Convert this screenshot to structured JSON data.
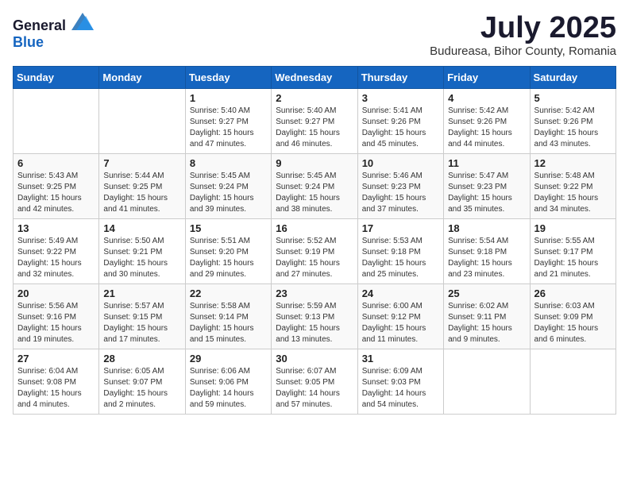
{
  "logo": {
    "text_general": "General",
    "text_blue": "Blue"
  },
  "title": {
    "month_year": "July 2025",
    "location": "Budureasa, Bihor County, Romania"
  },
  "days_of_week": [
    "Sunday",
    "Monday",
    "Tuesday",
    "Wednesday",
    "Thursday",
    "Friday",
    "Saturday"
  ],
  "weeks": [
    [
      {
        "day": "",
        "sunrise": "",
        "sunset": "",
        "daylight": ""
      },
      {
        "day": "",
        "sunrise": "",
        "sunset": "",
        "daylight": ""
      },
      {
        "day": "1",
        "sunrise": "Sunrise: 5:40 AM",
        "sunset": "Sunset: 9:27 PM",
        "daylight": "Daylight: 15 hours and 47 minutes."
      },
      {
        "day": "2",
        "sunrise": "Sunrise: 5:40 AM",
        "sunset": "Sunset: 9:27 PM",
        "daylight": "Daylight: 15 hours and 46 minutes."
      },
      {
        "day": "3",
        "sunrise": "Sunrise: 5:41 AM",
        "sunset": "Sunset: 9:26 PM",
        "daylight": "Daylight: 15 hours and 45 minutes."
      },
      {
        "day": "4",
        "sunrise": "Sunrise: 5:42 AM",
        "sunset": "Sunset: 9:26 PM",
        "daylight": "Daylight: 15 hours and 44 minutes."
      },
      {
        "day": "5",
        "sunrise": "Sunrise: 5:42 AM",
        "sunset": "Sunset: 9:26 PM",
        "daylight": "Daylight: 15 hours and 43 minutes."
      }
    ],
    [
      {
        "day": "6",
        "sunrise": "Sunrise: 5:43 AM",
        "sunset": "Sunset: 9:25 PM",
        "daylight": "Daylight: 15 hours and 42 minutes."
      },
      {
        "day": "7",
        "sunrise": "Sunrise: 5:44 AM",
        "sunset": "Sunset: 9:25 PM",
        "daylight": "Daylight: 15 hours and 41 minutes."
      },
      {
        "day": "8",
        "sunrise": "Sunrise: 5:45 AM",
        "sunset": "Sunset: 9:24 PM",
        "daylight": "Daylight: 15 hours and 39 minutes."
      },
      {
        "day": "9",
        "sunrise": "Sunrise: 5:45 AM",
        "sunset": "Sunset: 9:24 PM",
        "daylight": "Daylight: 15 hours and 38 minutes."
      },
      {
        "day": "10",
        "sunrise": "Sunrise: 5:46 AM",
        "sunset": "Sunset: 9:23 PM",
        "daylight": "Daylight: 15 hours and 37 minutes."
      },
      {
        "day": "11",
        "sunrise": "Sunrise: 5:47 AM",
        "sunset": "Sunset: 9:23 PM",
        "daylight": "Daylight: 15 hours and 35 minutes."
      },
      {
        "day": "12",
        "sunrise": "Sunrise: 5:48 AM",
        "sunset": "Sunset: 9:22 PM",
        "daylight": "Daylight: 15 hours and 34 minutes."
      }
    ],
    [
      {
        "day": "13",
        "sunrise": "Sunrise: 5:49 AM",
        "sunset": "Sunset: 9:22 PM",
        "daylight": "Daylight: 15 hours and 32 minutes."
      },
      {
        "day": "14",
        "sunrise": "Sunrise: 5:50 AM",
        "sunset": "Sunset: 9:21 PM",
        "daylight": "Daylight: 15 hours and 30 minutes."
      },
      {
        "day": "15",
        "sunrise": "Sunrise: 5:51 AM",
        "sunset": "Sunset: 9:20 PM",
        "daylight": "Daylight: 15 hours and 29 minutes."
      },
      {
        "day": "16",
        "sunrise": "Sunrise: 5:52 AM",
        "sunset": "Sunset: 9:19 PM",
        "daylight": "Daylight: 15 hours and 27 minutes."
      },
      {
        "day": "17",
        "sunrise": "Sunrise: 5:53 AM",
        "sunset": "Sunset: 9:18 PM",
        "daylight": "Daylight: 15 hours and 25 minutes."
      },
      {
        "day": "18",
        "sunrise": "Sunrise: 5:54 AM",
        "sunset": "Sunset: 9:18 PM",
        "daylight": "Daylight: 15 hours and 23 minutes."
      },
      {
        "day": "19",
        "sunrise": "Sunrise: 5:55 AM",
        "sunset": "Sunset: 9:17 PM",
        "daylight": "Daylight: 15 hours and 21 minutes."
      }
    ],
    [
      {
        "day": "20",
        "sunrise": "Sunrise: 5:56 AM",
        "sunset": "Sunset: 9:16 PM",
        "daylight": "Daylight: 15 hours and 19 minutes."
      },
      {
        "day": "21",
        "sunrise": "Sunrise: 5:57 AM",
        "sunset": "Sunset: 9:15 PM",
        "daylight": "Daylight: 15 hours and 17 minutes."
      },
      {
        "day": "22",
        "sunrise": "Sunrise: 5:58 AM",
        "sunset": "Sunset: 9:14 PM",
        "daylight": "Daylight: 15 hours and 15 minutes."
      },
      {
        "day": "23",
        "sunrise": "Sunrise: 5:59 AM",
        "sunset": "Sunset: 9:13 PM",
        "daylight": "Daylight: 15 hours and 13 minutes."
      },
      {
        "day": "24",
        "sunrise": "Sunrise: 6:00 AM",
        "sunset": "Sunset: 9:12 PM",
        "daylight": "Daylight: 15 hours and 11 minutes."
      },
      {
        "day": "25",
        "sunrise": "Sunrise: 6:02 AM",
        "sunset": "Sunset: 9:11 PM",
        "daylight": "Daylight: 15 hours and 9 minutes."
      },
      {
        "day": "26",
        "sunrise": "Sunrise: 6:03 AM",
        "sunset": "Sunset: 9:09 PM",
        "daylight": "Daylight: 15 hours and 6 minutes."
      }
    ],
    [
      {
        "day": "27",
        "sunrise": "Sunrise: 6:04 AM",
        "sunset": "Sunset: 9:08 PM",
        "daylight": "Daylight: 15 hours and 4 minutes."
      },
      {
        "day": "28",
        "sunrise": "Sunrise: 6:05 AM",
        "sunset": "Sunset: 9:07 PM",
        "daylight": "Daylight: 15 hours and 2 minutes."
      },
      {
        "day": "29",
        "sunrise": "Sunrise: 6:06 AM",
        "sunset": "Sunset: 9:06 PM",
        "daylight": "Daylight: 14 hours and 59 minutes."
      },
      {
        "day": "30",
        "sunrise": "Sunrise: 6:07 AM",
        "sunset": "Sunset: 9:05 PM",
        "daylight": "Daylight: 14 hours and 57 minutes."
      },
      {
        "day": "31",
        "sunrise": "Sunrise: 6:09 AM",
        "sunset": "Sunset: 9:03 PM",
        "daylight": "Daylight: 14 hours and 54 minutes."
      },
      {
        "day": "",
        "sunrise": "",
        "sunset": "",
        "daylight": ""
      },
      {
        "day": "",
        "sunrise": "",
        "sunset": "",
        "daylight": ""
      }
    ]
  ]
}
